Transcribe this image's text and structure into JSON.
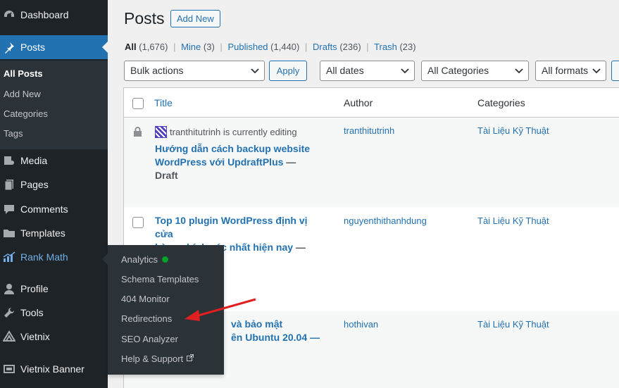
{
  "sidebar": {
    "items": [
      {
        "label": "Dashboard",
        "icon": "dashboard-icon"
      },
      {
        "label": "Posts",
        "icon": "pushpin-icon"
      },
      {
        "label": "Media",
        "icon": "media-icon"
      },
      {
        "label": "Pages",
        "icon": "pages-icon"
      },
      {
        "label": "Comments",
        "icon": "comment-icon"
      },
      {
        "label": "Templates",
        "icon": "folder-icon"
      },
      {
        "label": "Rank Math",
        "icon": "rank-math-icon"
      },
      {
        "label": "Profile",
        "icon": "user-icon"
      },
      {
        "label": "Tools",
        "icon": "wrench-icon"
      },
      {
        "label": "Vietnix",
        "icon": "vietnix-icon"
      },
      {
        "label": "Vietnix Banner",
        "icon": "banner-icon"
      }
    ],
    "posts_submenu": [
      "All Posts",
      "Add New",
      "Categories",
      "Tags"
    ]
  },
  "rankmath_flyout": [
    "Analytics",
    "Schema Templates",
    "404 Monitor",
    "Redirections",
    "SEO Analyzer",
    "Help & Support"
  ],
  "page": {
    "title": "Posts",
    "add_new": "Add New"
  },
  "views": {
    "all": "All",
    "all_count": "(1,676)",
    "mine": "Mine",
    "mine_count": "(3)",
    "published": "Published",
    "published_count": "(1,440)",
    "drafts": "Drafts",
    "drafts_count": "(236)",
    "trash": "Trash",
    "trash_count": "(23)",
    "separator": "|"
  },
  "filters": {
    "bulk": "Bulk actions",
    "apply": "Apply",
    "dates": "All dates",
    "categories": "All Categories",
    "formats": "All formats"
  },
  "table": {
    "headers": {
      "title": "Title",
      "author": "Author",
      "categories": "Categories"
    },
    "rows": [
      {
        "editing_note": "tranthitutrinh is currently editing",
        "title_line1": "Hướng dẫn cách backup website",
        "title_line2": "WordPress với UpdraftPlus",
        "state": " — Draft",
        "author": "tranthitutrinh",
        "category": "Tài Liệu Kỹ Thuật"
      },
      {
        "title_line1": "Top 10 plugin WordPress định vị cửa",
        "title_line2": "hàng chính xác nhất hiện nay",
        "state": " — Draft",
        "author": "nguyenthithanhdung",
        "category": "Tài Liệu Kỹ Thuật"
      },
      {
        "title_line1": "và bảo mật",
        "title_line2": "ên Ubuntu 20.04 —",
        "author": "hothivan",
        "category": "Tài Liệu Kỹ Thuật"
      }
    ]
  },
  "colors": {
    "accent": "#2271b1",
    "sidebar": "#1d2327",
    "arrow": "#e02020",
    "analytics_dot": "#00a32a"
  }
}
